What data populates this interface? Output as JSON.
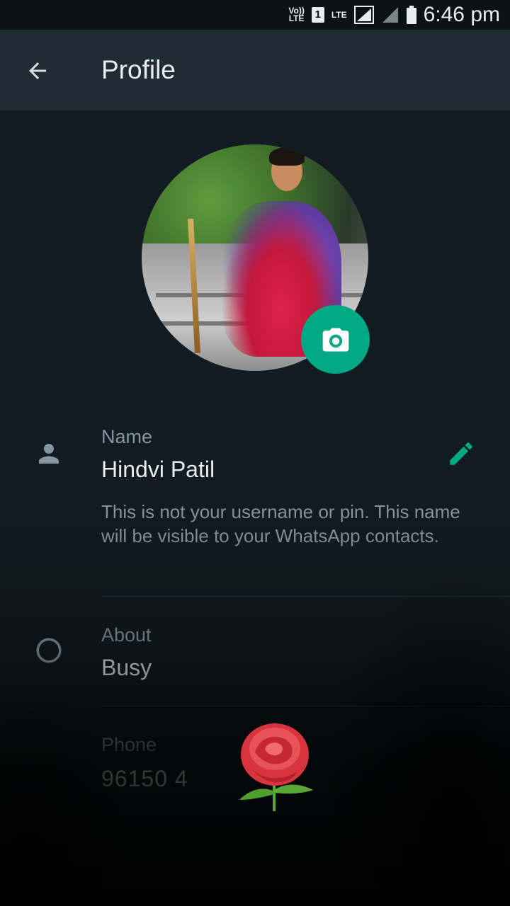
{
  "status_bar": {
    "volte_top": "Vo))",
    "volte_bottom": "LTE",
    "sim": "1",
    "lte": "LTE",
    "time": "6:46 pm"
  },
  "app_bar": {
    "title": "Profile",
    "back_icon": "arrow-left-icon"
  },
  "profile": {
    "camera_icon": "camera-icon",
    "name": {
      "label": "Name",
      "value": "Hindvi Patil",
      "helper": "This is not your username or pin. This name will be visible to your WhatsApp contacts.",
      "edit_icon": "pencil-icon"
    },
    "about": {
      "label": "About",
      "value": "Busy"
    },
    "phone": {
      "label": "Phone",
      "value": "96150 4"
    }
  },
  "colors": {
    "background": "#111b21",
    "app_bar": "#1f2c33",
    "accent": "#00a884",
    "primary_text": "#e9edef",
    "secondary_text": "#8696a0"
  }
}
